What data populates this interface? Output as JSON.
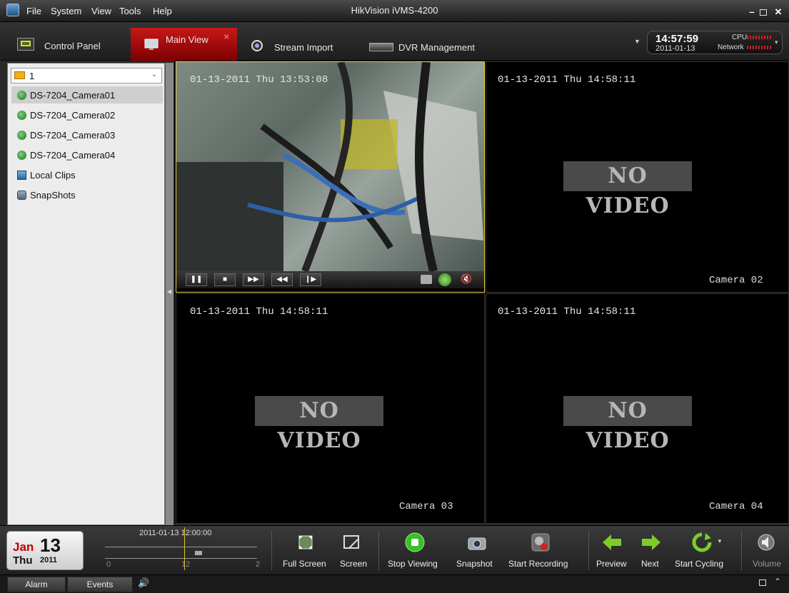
{
  "app": {
    "title": "HikVision iVMS-4200"
  },
  "menu": [
    "File",
    "System",
    "View",
    "Tools",
    "Help"
  ],
  "tabs": [
    {
      "label": "Control Panel"
    },
    {
      "label": "Main View"
    },
    {
      "label": "Stream Import"
    },
    {
      "label": "DVR Management"
    }
  ],
  "status": {
    "time": "14:57:59",
    "date": "2011-01-13",
    "cpu_label": "CPU",
    "network_label": "Network"
  },
  "sidebar": {
    "group": "1",
    "items": [
      {
        "label": "DS-7204_Camera01",
        "icon": "camera-icon"
      },
      {
        "label": "DS-7204_Camera02",
        "icon": "camera-icon"
      },
      {
        "label": "DS-7204_Camera03",
        "icon": "camera-icon"
      },
      {
        "label": "DS-7204_Camera04",
        "icon": "camera-icon"
      },
      {
        "label": "Local Clips",
        "icon": "clips-icon"
      },
      {
        "label": "SnapShots",
        "icon": "snapshot-icon"
      }
    ]
  },
  "panes": [
    {
      "osd": "01-13-2011 Thu 13:53:08",
      "camera": ""
    },
    {
      "osd": "01-13-2011 Thu 14:58:11",
      "camera": "Camera 02",
      "novideo": "NO VIDEO"
    },
    {
      "osd": "01-13-2011 Thu 14:58:11",
      "camera": "Camera 03",
      "novideo": "NO VIDEO"
    },
    {
      "osd": "01-13-2011 Thu 14:58:11",
      "camera": "Camera 04",
      "novideo": "NO VIDEO"
    }
  ],
  "calendar": {
    "month": "Jan",
    "day": "13",
    "weekday": "Thu",
    "year": "2011"
  },
  "timeline": {
    "label": "2011-01-13 12:00:00",
    "ticks": [
      "0",
      "12",
      "2"
    ]
  },
  "toolbar": {
    "full_screen": "Full Screen",
    "screen": "Screen",
    "stop_viewing": "Stop Viewing",
    "snapshot": "Snapshot",
    "start_recording": "Start Recording",
    "preview": "Preview",
    "next": "Next",
    "start_cycling": "Start Cycling",
    "volume": "Volume"
  },
  "statusbar": {
    "alarm": "Alarm",
    "events": "Events"
  },
  "colors": {
    "active_tab": "#c81818",
    "green_button": "#3bbf2a",
    "nav_arrow": "#7ccd2b",
    "highlight_border": "#e6d24a"
  }
}
